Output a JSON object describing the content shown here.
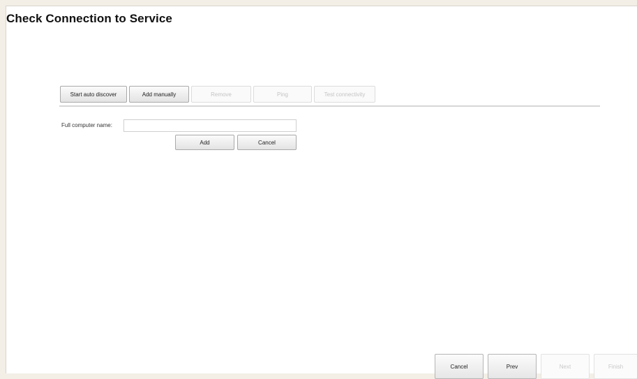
{
  "page": {
    "title": "Check Connection to Service"
  },
  "toolbar": {
    "start_auto_discover": "Start auto discover",
    "add_manually": "Add manually",
    "remove": "Remove",
    "ping": "Ping",
    "test_connectivity": "Test connectivity"
  },
  "add_form": {
    "label": "Full computer name:",
    "value": "",
    "placeholder": "",
    "add_label": "Add",
    "cancel_label": "Cancel"
  },
  "wizard_nav": {
    "cancel": "Cancel",
    "prev": "Prev",
    "next": "Next",
    "finish": "Finish"
  },
  "colors": {
    "background": "#ffffff",
    "frame": "#f3efe6",
    "disabled_text": "#c4c4c4"
  }
}
